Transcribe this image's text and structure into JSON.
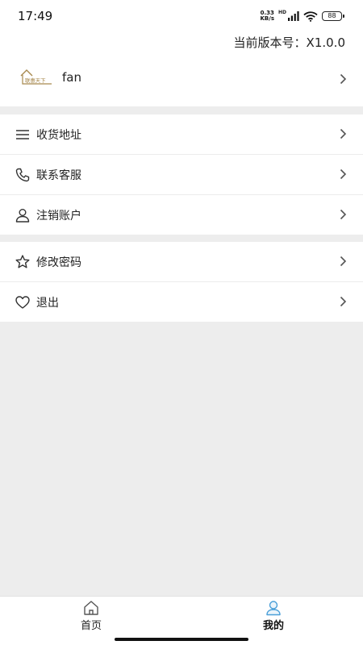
{
  "status_bar": {
    "time": "17:49",
    "net_speed_value": "0.33",
    "net_speed_unit": "KB/s",
    "network_tag": "HD",
    "battery": "88"
  },
  "header": {
    "version_text": "当前版本号：X1.0.0"
  },
  "profile": {
    "logo_text": "联惠天下",
    "username": "fan"
  },
  "menu_group_1": {
    "items": [
      {
        "label": "收货地址",
        "icon": "list-icon"
      },
      {
        "label": "联系客服",
        "icon": "phone-icon"
      },
      {
        "label": "注销账户",
        "icon": "person-icon"
      }
    ]
  },
  "menu_group_2": {
    "items": [
      {
        "label": "修改密码",
        "icon": "star-icon"
      },
      {
        "label": "退出",
        "icon": "heart-icon"
      }
    ]
  },
  "bottom_nav": {
    "tabs": [
      {
        "label": "首页",
        "icon": "home-icon",
        "active": false
      },
      {
        "label": "我的",
        "icon": "user-icon",
        "active": true
      }
    ]
  },
  "colors": {
    "background": "#ededed",
    "surface": "#ffffff",
    "text": "#222222",
    "active_icon": "#4a9fd8",
    "logo_gold": "#a8894e"
  }
}
